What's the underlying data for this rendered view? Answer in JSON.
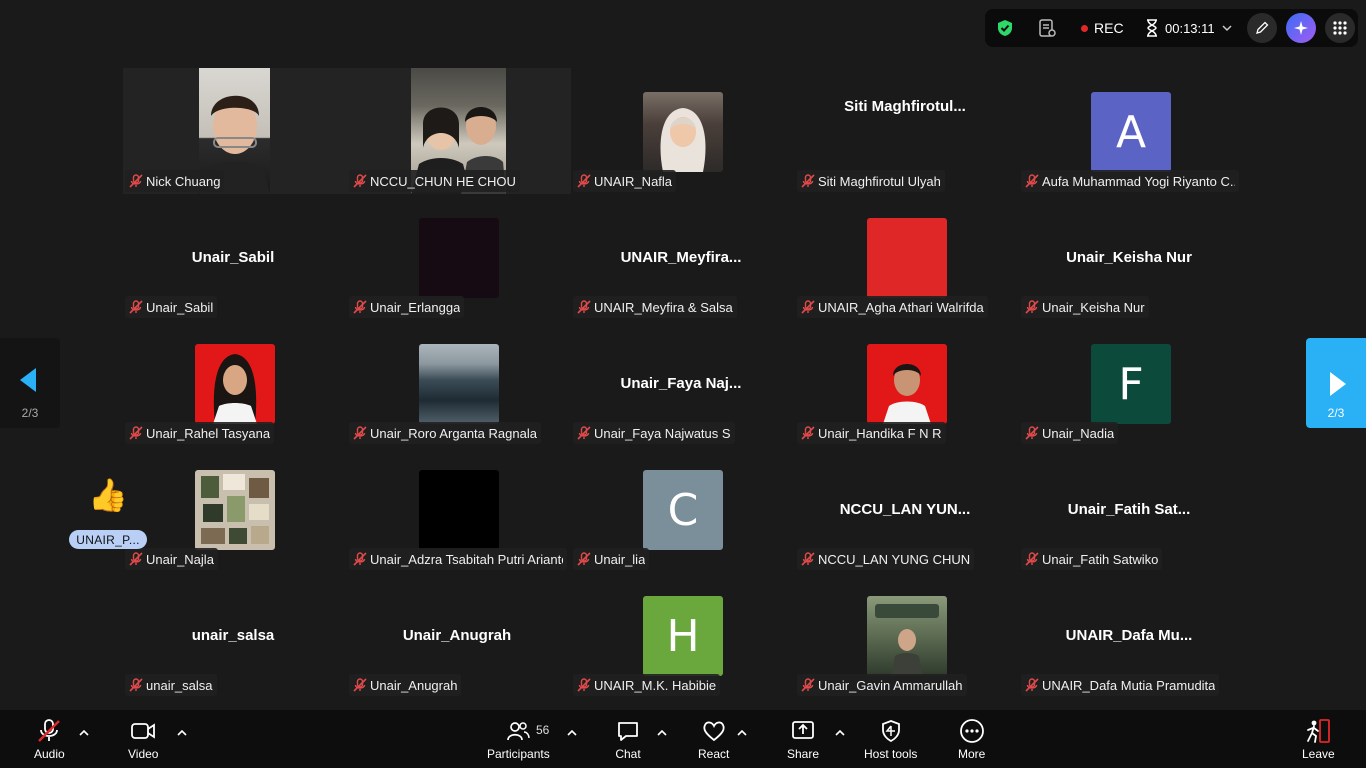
{
  "topbar": {
    "rec_label": "REC",
    "timer": "00:13:11",
    "icons": [
      "shield-check-icon",
      "notes-icon",
      "hourglass-icon",
      "chevron-down-icon",
      "pencil-icon",
      "ai-companion-icon",
      "apps-grid-icon"
    ]
  },
  "tiles": [
    {
      "name": "Nick Chuang"
    },
    {
      "name": "NCCU_CHUN HE CHOU"
    },
    {
      "name": "UNAIR_Nafla"
    },
    {
      "name": "Siti Maghfirotul Ulyah",
      "big_name": "Siti  Maghfirotul..."
    },
    {
      "name": "Aufa Muhammad Yogi Riyanto C...",
      "letter": "A"
    },
    {
      "name": "Unair_Sabil",
      "big_name": "Unair_Sabil"
    },
    {
      "name": "Unair_Erlangga"
    },
    {
      "name": "UNAIR_Meyfira & Salsa",
      "big_name": "UNAIR_Meyfira..."
    },
    {
      "name": "UNAIR_Agha Athari Walrifda"
    },
    {
      "name": "Unair_Keisha Nur",
      "big_name": "Unair_Keisha Nur"
    },
    {
      "name": "Unair_Rahel Tasyana"
    },
    {
      "name": "Unair_Roro Arganta Ragnala"
    },
    {
      "name": "Unair_Faya Najwatus S",
      "big_name": "Unair_Faya  Naj..."
    },
    {
      "name": "Unair_Handika F N R"
    },
    {
      "name": "Unair_Nadia",
      "letter": "F"
    },
    {
      "name": "Unair_Najla"
    },
    {
      "name": "Unair_Adzra Tsabitah Putri Arianto"
    },
    {
      "name": "Unair_lia",
      "letter": "C"
    },
    {
      "name": "NCCU_LAN YUNG CHUN",
      "big_name": "NCCU_LAN  YUN..."
    },
    {
      "name": "Unair_Fatih Satwiko",
      "big_name": "Unair_Fatih  Sat..."
    },
    {
      "name": "unair_salsa",
      "big_name": "unair_salsa"
    },
    {
      "name": "Unair_Anugrah",
      "big_name": "Unair_Anugrah"
    },
    {
      "name": "UNAIR_M.K. Habibie",
      "letter": "H"
    },
    {
      "name": "Unair_Gavin Ammarullah"
    },
    {
      "name": "UNAIR_Dafa Mutia Pramudita",
      "big_name": "UNAIR_Dafa  Mu..."
    }
  ],
  "avatar_colors": {
    "aufa": "#5b63c4",
    "nadia": "#0c4a3c",
    "lia": "#7a8f99",
    "habibie": "#6aa83e",
    "agha": "#e02727",
    "erlangga": "#170b13",
    "adzra": "#000000",
    "rahel_bg": "#e21818",
    "handika_bg": "#e21818"
  },
  "pagination": {
    "left": "2/3",
    "right": "2/3"
  },
  "reaction": {
    "emoji": "👍",
    "user": "UNAIR_P..."
  },
  "toolbar": {
    "audio": "Audio",
    "video": "Video",
    "participants": "Participants",
    "participants_count": "56",
    "chat": "Chat",
    "react": "React",
    "share": "Share",
    "host_tools": "Host tools",
    "more": "More",
    "leave": "Leave"
  }
}
